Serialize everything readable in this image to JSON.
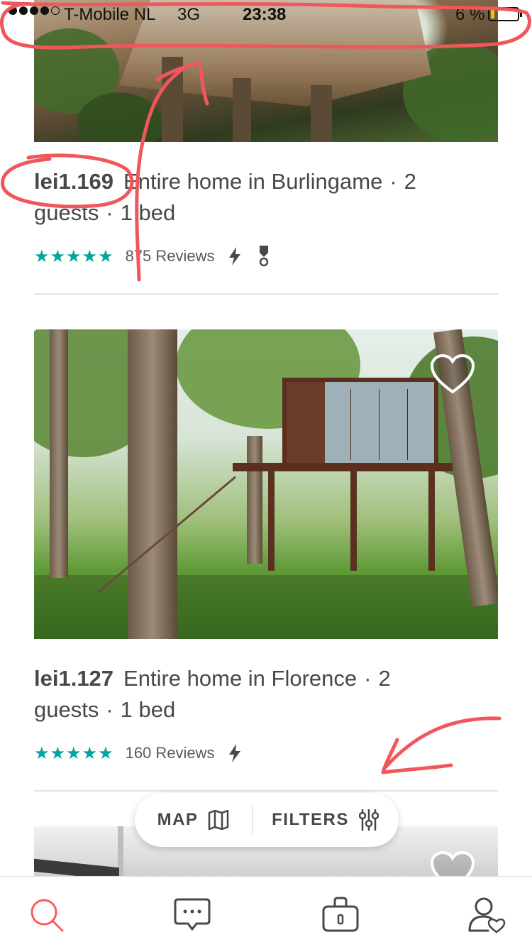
{
  "status_bar": {
    "carrier": "T-Mobile NL",
    "network": "3G",
    "time": "23:38",
    "battery": "6 %",
    "battery_level": 0.06
  },
  "listings": [
    {
      "price": "lei1.169",
      "type_location": "Entire home in Burlingame",
      "guests": "2 guests",
      "beds": "1 bed",
      "stars": "★★★★★",
      "rating": 5,
      "reviews": "875 Reviews",
      "instant_book_icon": "bolt-icon",
      "extra_icon": "badge-icon"
    },
    {
      "price": "lei1.127",
      "type_location": "Entire home in Florence",
      "guests": "2 guests",
      "beds": "1 bed",
      "stars": "★★★★★",
      "rating": 5,
      "reviews": "160 Reviews",
      "instant_book_icon": "bolt-icon"
    }
  ],
  "floating_actions": {
    "map_label": "MAP",
    "map_icon": "map-icon",
    "filters_label": "FILTERS",
    "filters_icon": "sliders-icon"
  },
  "tab_bar": {
    "items": [
      {
        "icon": "search-icon",
        "active": true
      },
      {
        "icon": "chat-bubble-icon",
        "active": false
      },
      {
        "icon": "bag-icon",
        "active": false
      },
      {
        "icon": "profile-icon",
        "active": false
      }
    ]
  },
  "colors": {
    "accent": "#ff5a5f",
    "stars": "#00a699",
    "text": "#484848",
    "annotation": "#f0575b"
  }
}
